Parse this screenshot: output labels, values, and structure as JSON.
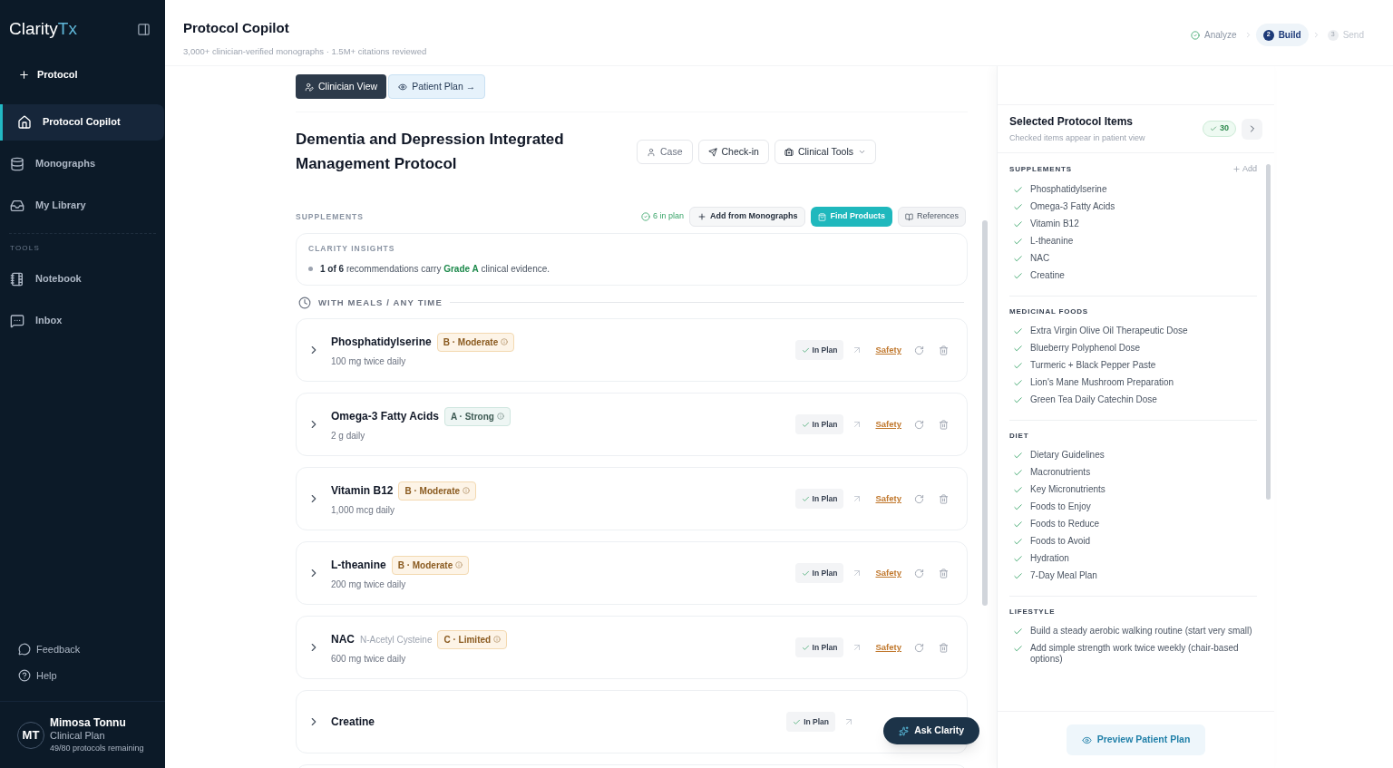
{
  "sidebar": {
    "logo": {
      "main": "Clarity",
      "accent": "Tx"
    },
    "new_button": "Protocol",
    "items": [
      {
        "label": "Protocol Copilot",
        "selected": true
      },
      {
        "label": "Monographs",
        "selected": false
      },
      {
        "label": "My Library",
        "selected": false
      }
    ],
    "tools_heading": "TOOLS",
    "tools": [
      {
        "label": "Notebook",
        "selected": false
      },
      {
        "label": "Inbox",
        "selected": false
      }
    ],
    "footer_links": [
      "Feedback",
      "Help"
    ],
    "user": {
      "initials": "MT",
      "name": "Mimosa Tonnu",
      "plan": "Clinical Plan",
      "quota": "49/80 protocols remaining"
    }
  },
  "header": {
    "title": "Protocol Copilot",
    "subtitle": "3,000+ clinician-verified monographs · 1.5M+ citations reviewed",
    "steps": [
      {
        "label": "Analyze",
        "kind": "done"
      },
      {
        "label": "Build",
        "number": "2",
        "kind": "current"
      },
      {
        "label": "Send",
        "number": "3",
        "kind": "pending"
      }
    ]
  },
  "view_toggle": [
    {
      "label": "Clinician View",
      "selected": true
    },
    {
      "label": "Patient Plan →",
      "selected": false
    }
  ],
  "protocol": {
    "title": "Dementia and Depression Integrated Management Protocol",
    "actions": [
      {
        "label": "Case",
        "dropdown": false
      },
      {
        "label": "Check-in",
        "dropdown": false
      },
      {
        "label": "Clinical Tools",
        "dropdown": true
      }
    ]
  },
  "supplements": {
    "heading": "SUPPLEMENTS",
    "in_plan": "6 in plan",
    "add_button": "Add from Monographs",
    "find_button": "Find Products",
    "references_button": "References",
    "insights": {
      "heading": "CLARITY INSIGHTS",
      "text": "**1 of 6** recommendations carry **Grade A** clinical evidence."
    },
    "group": "WITH MEALS / ANY TIME",
    "items": [
      {
        "name": "Phosphatidylserine",
        "grade": "B · Moderate",
        "kind": "moderate",
        "dose": "100 mg twice daily",
        "status": "In Plan",
        "safety": "Safety"
      },
      {
        "name": "Omega-3 Fatty Acids",
        "grade": "A · Strong",
        "kind": "strong",
        "dose": "2 g daily",
        "status": "In Plan",
        "safety": "Safety"
      },
      {
        "name": "Vitamin B12",
        "grade": "B · Moderate",
        "kind": "moderate",
        "dose": "1,000 mcg daily",
        "status": "In Plan",
        "safety": "Safety"
      },
      {
        "name": "L-theanine",
        "grade": "B · Moderate",
        "kind": "moderate",
        "dose": "200 mg twice daily",
        "status": "In Plan",
        "safety": "Safety"
      },
      {
        "name": "NAC",
        "alias": "N-Acetyl Cysteine",
        "grade": "C · Limited",
        "kind": "limited",
        "dose": "600 mg twice daily",
        "status": "In Plan",
        "safety": "Safety"
      },
      {
        "name": "Creatine",
        "status": "In Plan"
      }
    ]
  },
  "ask_button": "Ask Clarity",
  "selected_panel": {
    "title": "Selected Protocol Items",
    "subtitle": "Checked items appear in patient view",
    "count": "30",
    "add_label": "Add",
    "sections": [
      {
        "heading": "SUPPLEMENTS",
        "items": [
          {
            "label": "Phosphatidylserine",
            "checked": true
          },
          {
            "label": "Omega-3 Fatty Acids",
            "checked": true
          },
          {
            "label": "Vitamin B12",
            "checked": true
          },
          {
            "label": "L-theanine",
            "checked": true
          },
          {
            "label": "NAC",
            "checked": true
          },
          {
            "label": "Creatine",
            "checked": true
          }
        ]
      },
      {
        "heading": "MEDICINAL FOODS",
        "items": [
          {
            "label": "Extra Virgin Olive Oil Therapeutic Dose",
            "checked": true
          },
          {
            "label": "Blueberry Polyphenol Dose",
            "checked": true
          },
          {
            "label": "Turmeric + Black Pepper Paste",
            "checked": true
          },
          {
            "label": "Lion's Mane Mushroom Preparation",
            "checked": true
          },
          {
            "label": "Green Tea Daily Catechin Dose",
            "checked": true
          }
        ]
      },
      {
        "heading": "DIET",
        "items": [
          {
            "label": "Dietary Guidelines",
            "checked": true
          },
          {
            "label": "Macronutrients",
            "checked": true
          },
          {
            "label": "Key Micronutrients",
            "checked": true
          },
          {
            "label": "Foods to Enjoy",
            "checked": true
          },
          {
            "label": "Foods to Reduce",
            "checked": true
          },
          {
            "label": "Foods to Avoid",
            "checked": true
          },
          {
            "label": "Hydration",
            "checked": true
          },
          {
            "label": "7-Day Meal Plan",
            "checked": true
          }
        ]
      },
      {
        "heading": "LIFESTYLE",
        "items": [
          {
            "label": "Build a steady aerobic walking routine (start very small)",
            "checked": true
          },
          {
            "label": "Add simple strength work twice weekly (chair-based options)",
            "checked": true
          }
        ]
      }
    ],
    "preview_button": "Preview Patient Plan"
  }
}
